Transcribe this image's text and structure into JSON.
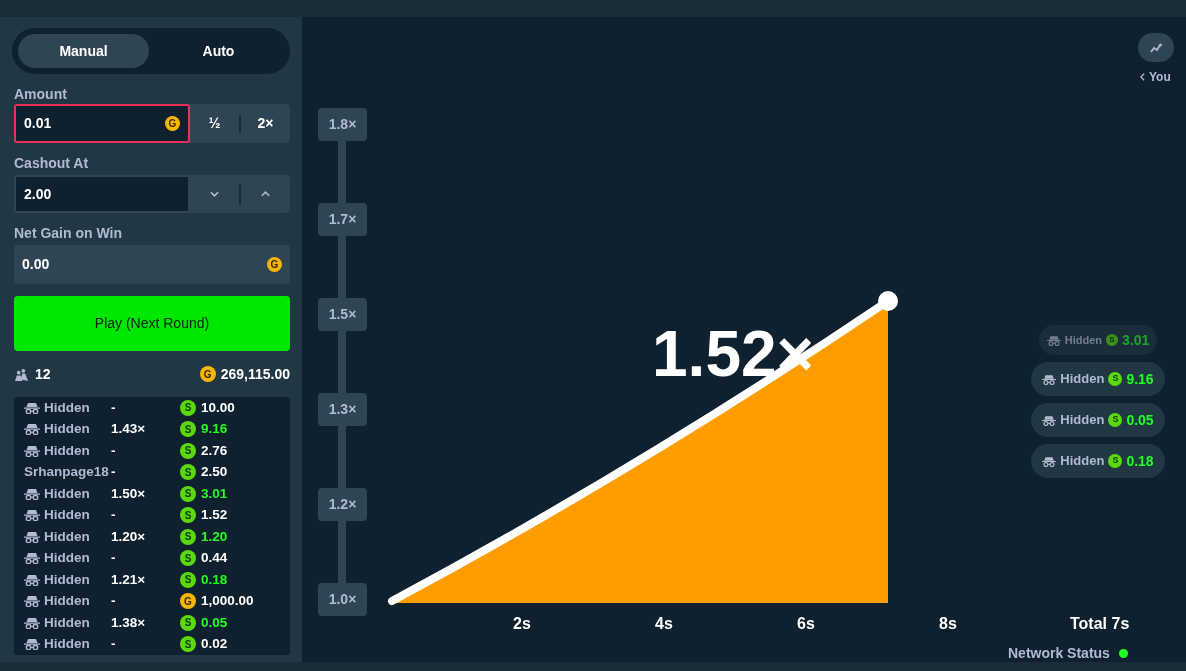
{
  "tabs": [
    {
      "label": "Manual",
      "selected": true
    },
    {
      "label": "Auto",
      "selected": false
    }
  ],
  "amount": {
    "label": "Amount",
    "value": "0.01",
    "focused": true,
    "coin": {
      "kind": "gold",
      "letter": "G"
    },
    "buttons": [
      "½",
      "2×"
    ]
  },
  "cashout": {
    "label": "Cashout At",
    "value": "2.00"
  },
  "net_gain": {
    "label": "Net Gain on Win",
    "value": "0.00",
    "coin": {
      "kind": "gold",
      "letter": "G"
    }
  },
  "play_button": "Play (Next Round)",
  "player_count": "12",
  "total": {
    "coin": {
      "kind": "gold",
      "letter": "G"
    },
    "amount": "269,115.00"
  },
  "bets": [
    {
      "player": "Hidden",
      "hidden": true,
      "multiplier": "-",
      "coin": {
        "kind": "cash",
        "letter": "S"
      },
      "amount": "10.00",
      "won": false
    },
    {
      "player": "Hidden",
      "hidden": true,
      "multiplier": "1.43×",
      "coin": {
        "kind": "cash",
        "letter": "S"
      },
      "amount": "9.16",
      "won": true
    },
    {
      "player": "Hidden",
      "hidden": true,
      "multiplier": "-",
      "coin": {
        "kind": "cash",
        "letter": "S"
      },
      "amount": "2.76",
      "won": false
    },
    {
      "player": "Srhanpage18",
      "hidden": false,
      "multiplier": "-",
      "coin": {
        "kind": "cash",
        "letter": "S"
      },
      "amount": "2.50",
      "won": false
    },
    {
      "player": "Hidden",
      "hidden": true,
      "multiplier": "1.50×",
      "coin": {
        "kind": "cash",
        "letter": "S"
      },
      "amount": "3.01",
      "won": true
    },
    {
      "player": "Hidden",
      "hidden": true,
      "multiplier": "-",
      "coin": {
        "kind": "cash",
        "letter": "S"
      },
      "amount": "1.52",
      "won": false
    },
    {
      "player": "Hidden",
      "hidden": true,
      "multiplier": "1.20×",
      "coin": {
        "kind": "cash",
        "letter": "S"
      },
      "amount": "1.20",
      "won": true
    },
    {
      "player": "Hidden",
      "hidden": true,
      "multiplier": "-",
      "coin": {
        "kind": "cash",
        "letter": "S"
      },
      "amount": "0.44",
      "won": false
    },
    {
      "player": "Hidden",
      "hidden": true,
      "multiplier": "1.21×",
      "coin": {
        "kind": "cash",
        "letter": "S"
      },
      "amount": "0.18",
      "won": true
    },
    {
      "player": "Hidden",
      "hidden": true,
      "multiplier": "-",
      "coin": {
        "kind": "gold",
        "letter": "G"
      },
      "amount": "1,000.00",
      "won": false
    },
    {
      "player": "Hidden",
      "hidden": true,
      "multiplier": "1.38×",
      "coin": {
        "kind": "cash",
        "letter": "S"
      },
      "amount": "0.05",
      "won": true
    },
    {
      "player": "Hidden",
      "hidden": true,
      "multiplier": "-",
      "coin": {
        "kind": "cash",
        "letter": "S"
      },
      "amount": "0.02",
      "won": false
    }
  ],
  "graph": {
    "multiplier": "1.52×",
    "y_ticks": [
      "1.8×",
      "1.7×",
      "1.5×",
      "1.3×",
      "1.2×",
      "1.0×"
    ],
    "x_ticks": [
      "2s",
      "4s",
      "6s",
      "8s"
    ],
    "total": "Total 7s"
  },
  "view_toggle": {
    "label": "You"
  },
  "cashouts": [
    {
      "player": "Hidden",
      "coin": {
        "kind": "cash",
        "letter": "S"
      },
      "amount": "3.01",
      "faded": true
    },
    {
      "player": "Hidden",
      "coin": {
        "kind": "cash",
        "letter": "S"
      },
      "amount": "9.16",
      "faded": false
    },
    {
      "player": "Hidden",
      "coin": {
        "kind": "cash",
        "letter": "S"
      },
      "amount": "0.05",
      "faded": false
    },
    {
      "player": "Hidden",
      "coin": {
        "kind": "cash",
        "letter": "S"
      },
      "amount": "0.18",
      "faded": false
    }
  ],
  "network_status": {
    "label": "Network Status",
    "online": true
  }
}
